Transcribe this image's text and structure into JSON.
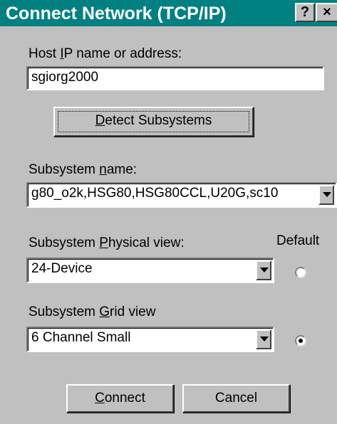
{
  "window": {
    "title": "Connect Network (TCP/IP)",
    "help_button": "?",
    "close_button": "×"
  },
  "host": {
    "label_pre": "Host ",
    "label_accel": "I",
    "label_post": "P name or address:",
    "value": "sgiorg2000"
  },
  "detect_button": {
    "accel": "D",
    "rest": "etect Subsystems"
  },
  "subsystem_name": {
    "label_pre": "Subsystem ",
    "label_accel": "n",
    "label_post": "ame:",
    "value": "g80_o2k,HSG80,HSG80CCL,U20G,sc10"
  },
  "physical_view": {
    "label_pre": "Subsystem ",
    "label_accel": "P",
    "label_post": "hysical view:",
    "value": "24-Device",
    "default_selected": false
  },
  "default_label": "Default",
  "grid_view": {
    "label_pre": "Subsystem ",
    "label_accel": "G",
    "label_post": "rid view",
    "value": "6 Channel Small",
    "default_selected": true
  },
  "buttons": {
    "connect_accel": "C",
    "connect_rest": "onnect",
    "cancel": "Cancel"
  },
  "colors": {
    "titlebar": "#008080",
    "dialog_face": "#c0c0c0"
  }
}
